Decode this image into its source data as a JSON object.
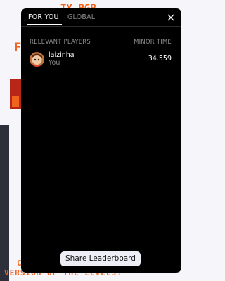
{
  "tabs": [
    {
      "label": "FOR YOU",
      "active": true
    },
    {
      "label": "GLOBAL",
      "active": false
    }
  ],
  "table": {
    "col_player": "RELEVANT PLAYERS",
    "col_time": "MINOR TIME"
  },
  "players": [
    {
      "name": "laizinha",
      "subtitle": "You",
      "time": "34.559"
    }
  ],
  "share_button": "Share Leaderboard",
  "background": {
    "bottom_text": "VERSION OF THE LEVELS!"
  },
  "colors": {
    "panel": "#000000",
    "accent_orange": "#f0641e",
    "muted_text": "#8c8c8c"
  },
  "icons": {
    "close": "close-icon"
  }
}
